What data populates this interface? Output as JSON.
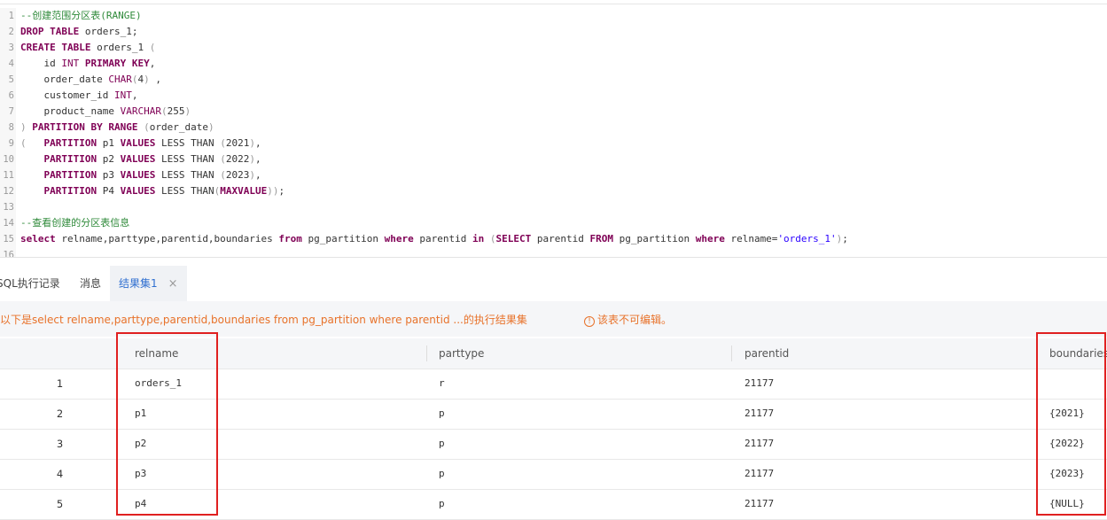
{
  "editor": {
    "lines": [
      {
        "n": "1",
        "segs": [
          {
            "t": "--创建范围分区表(RANGE)",
            "c": "cmt"
          }
        ]
      },
      {
        "n": "2",
        "segs": [
          {
            "t": "DROP TABLE",
            "c": "kw"
          },
          {
            "t": " orders_1;",
            "c": ""
          }
        ]
      },
      {
        "n": "3",
        "segs": [
          {
            "t": "CREATE TABLE",
            "c": "kw"
          },
          {
            "t": " orders_1 ",
            "c": ""
          },
          {
            "t": "(",
            "c": "dim"
          }
        ]
      },
      {
        "n": "4",
        "segs": [
          {
            "t": "    id ",
            "c": ""
          },
          {
            "t": "INT",
            "c": "kwn"
          },
          {
            "t": " ",
            "c": ""
          },
          {
            "t": "PRIMARY KEY",
            "c": "kw"
          },
          {
            "t": ",",
            "c": ""
          }
        ]
      },
      {
        "n": "5",
        "segs": [
          {
            "t": "    order_date ",
            "c": ""
          },
          {
            "t": "CHAR",
            "c": "kwn"
          },
          {
            "t": "(",
            "c": "dim"
          },
          {
            "t": "4",
            "c": ""
          },
          {
            "t": ")",
            "c": "dim"
          },
          {
            "t": " ,",
            "c": ""
          }
        ]
      },
      {
        "n": "6",
        "segs": [
          {
            "t": "    customer_id ",
            "c": ""
          },
          {
            "t": "INT",
            "c": "kwn"
          },
          {
            "t": ",",
            "c": ""
          }
        ]
      },
      {
        "n": "7",
        "segs": [
          {
            "t": "    product_name ",
            "c": ""
          },
          {
            "t": "VARCHAR",
            "c": "kwn"
          },
          {
            "t": "(",
            "c": "dim"
          },
          {
            "t": "255",
            "c": ""
          },
          {
            "t": ")",
            "c": "dim"
          }
        ]
      },
      {
        "n": "8",
        "segs": [
          {
            "t": ")",
            "c": "dim"
          },
          {
            "t": " ",
            "c": ""
          },
          {
            "t": "PARTITION BY RANGE",
            "c": "kw"
          },
          {
            "t": " ",
            "c": ""
          },
          {
            "t": "(",
            "c": "dim"
          },
          {
            "t": "order_date",
            "c": ""
          },
          {
            "t": ")",
            "c": "dim"
          }
        ]
      },
      {
        "n": "9",
        "segs": [
          {
            "t": "(",
            "c": "dim"
          },
          {
            "t": "   ",
            "c": ""
          },
          {
            "t": "PARTITION",
            "c": "kw"
          },
          {
            "t": " p1 ",
            "c": ""
          },
          {
            "t": "VALUES",
            "c": "kw"
          },
          {
            "t": " LESS THAN ",
            "c": ""
          },
          {
            "t": "(",
            "c": "dim"
          },
          {
            "t": "2021",
            "c": ""
          },
          {
            "t": ")",
            "c": "dim"
          },
          {
            "t": ",",
            "c": ""
          }
        ]
      },
      {
        "n": "10",
        "segs": [
          {
            "t": "    ",
            "c": ""
          },
          {
            "t": "PARTITION",
            "c": "kw"
          },
          {
            "t": " p2 ",
            "c": ""
          },
          {
            "t": "VALUES",
            "c": "kw"
          },
          {
            "t": " LESS THAN ",
            "c": ""
          },
          {
            "t": "(",
            "c": "dim"
          },
          {
            "t": "2022",
            "c": ""
          },
          {
            "t": ")",
            "c": "dim"
          },
          {
            "t": ",",
            "c": ""
          }
        ]
      },
      {
        "n": "11",
        "segs": [
          {
            "t": "    ",
            "c": ""
          },
          {
            "t": "PARTITION",
            "c": "kw"
          },
          {
            "t": " p3 ",
            "c": ""
          },
          {
            "t": "VALUES",
            "c": "kw"
          },
          {
            "t": " LESS THAN ",
            "c": ""
          },
          {
            "t": "(",
            "c": "dim"
          },
          {
            "t": "2023",
            "c": ""
          },
          {
            "t": ")",
            "c": "dim"
          },
          {
            "t": ",",
            "c": ""
          }
        ]
      },
      {
        "n": "12",
        "segs": [
          {
            "t": "    ",
            "c": ""
          },
          {
            "t": "PARTITION",
            "c": "kw"
          },
          {
            "t": " P4 ",
            "c": ""
          },
          {
            "t": "VALUES",
            "c": "kw"
          },
          {
            "t": " LESS THAN",
            "c": ""
          },
          {
            "t": "(",
            "c": "dim"
          },
          {
            "t": "MAXVALUE",
            "c": "kw"
          },
          {
            "t": "))",
            "c": "dim"
          },
          {
            "t": ";",
            "c": ""
          }
        ]
      },
      {
        "n": "13",
        "segs": []
      },
      {
        "n": "14",
        "segs": [
          {
            "t": "--查看创建的分区表信息",
            "c": "cmt"
          }
        ]
      },
      {
        "n": "15",
        "segs": [
          {
            "t": "select",
            "c": "kw"
          },
          {
            "t": " relname,parttype,parentid,boundaries ",
            "c": ""
          },
          {
            "t": "from",
            "c": "kw"
          },
          {
            "t": " pg_partition ",
            "c": ""
          },
          {
            "t": "where",
            "c": "kw"
          },
          {
            "t": " parentid ",
            "c": ""
          },
          {
            "t": "in",
            "c": "kw"
          },
          {
            "t": " ",
            "c": ""
          },
          {
            "t": "(",
            "c": "dim"
          },
          {
            "t": "SELECT",
            "c": "kw"
          },
          {
            "t": " parentid ",
            "c": ""
          },
          {
            "t": "FROM",
            "c": "kw"
          },
          {
            "t": " pg_partition ",
            "c": ""
          },
          {
            "t": "where",
            "c": "kw"
          },
          {
            "t": " relname=",
            "c": ""
          },
          {
            "t": "'orders_1'",
            "c": "str"
          },
          {
            "t": ")",
            "c": "dim"
          },
          {
            "t": ";",
            "c": ""
          }
        ]
      },
      {
        "n": "16",
        "segs": []
      }
    ]
  },
  "tabs": {
    "history": "SQL执行记录",
    "messages": "消息",
    "result": "结果集1",
    "close_glyph": "×"
  },
  "infobar": {
    "text": "以下是select relname,parttype,parentid,boundaries from pg_partition where parentid ...的执行结果集",
    "warning_glyph": "!",
    "warning": "该表不可编辑。"
  },
  "table": {
    "columns": [
      "relname",
      "parttype",
      "parentid",
      "boundaries"
    ],
    "rows": [
      {
        "idx": "1",
        "relname": "orders_1",
        "parttype": "r",
        "parentid": "21177",
        "boundaries": ""
      },
      {
        "idx": "2",
        "relname": "p1",
        "parttype": "p",
        "parentid": "21177",
        "boundaries": "{2021}"
      },
      {
        "idx": "3",
        "relname": "p2",
        "parttype": "p",
        "parentid": "21177",
        "boundaries": "{2022}"
      },
      {
        "idx": "4",
        "relname": "p3",
        "parttype": "p",
        "parentid": "21177",
        "boundaries": "{2023}"
      },
      {
        "idx": "5",
        "relname": "p4",
        "parttype": "p",
        "parentid": "21177",
        "boundaries": "{NULL}"
      }
    ]
  },
  "colors": {
    "highlight_box": "#e02020",
    "accent": "#2f6fd0",
    "warning": "#e8722a"
  }
}
